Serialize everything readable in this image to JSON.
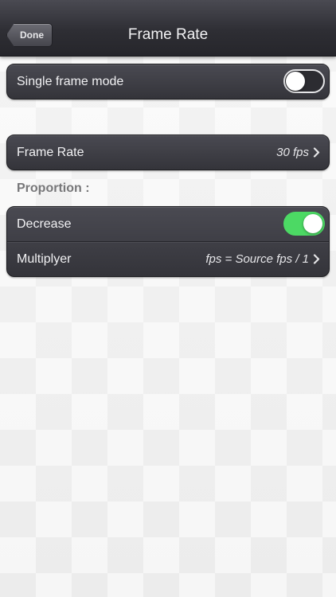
{
  "navbar": {
    "done_label": "Done",
    "title": "Frame Rate"
  },
  "single_frame": {
    "label": "Single frame mode",
    "enabled": false
  },
  "frame_rate": {
    "label": "Frame Rate",
    "value": "30 fps"
  },
  "proportion": {
    "header": "Proportion :",
    "decrease_label": "Decrease",
    "decrease_enabled": true,
    "multiplyer_label": "Multiplyer",
    "multiplyer_value": "fps = Source fps / 1"
  },
  "colors": {
    "toggle_on": "#4cd964",
    "navbar": "#2e2e34",
    "cell": "#3c3c42"
  },
  "icons": {
    "chevron": "chevron-right-icon"
  }
}
